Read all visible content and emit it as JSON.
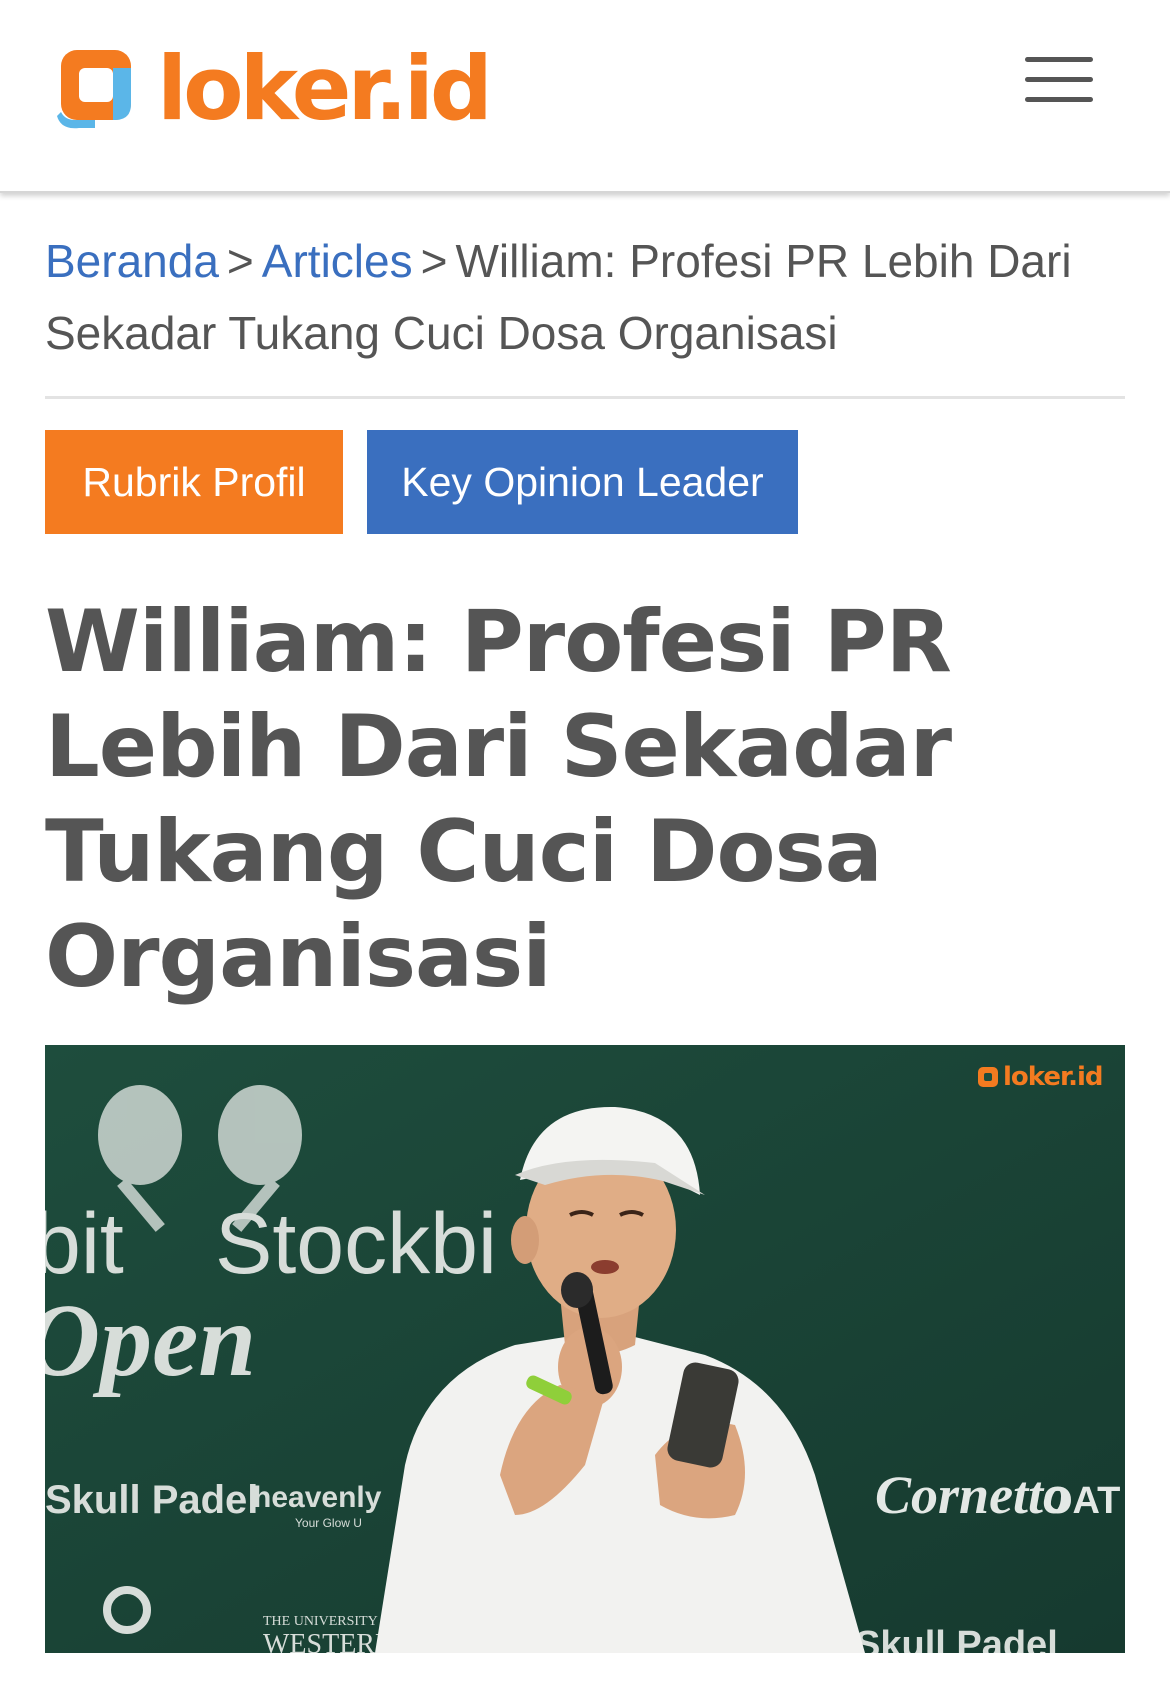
{
  "header": {
    "logo_text": "loker.id",
    "menu_icon": "hamburger-menu-icon"
  },
  "breadcrumb": {
    "home": "Beranda",
    "section": "Articles",
    "separator": ">",
    "current": "William: Profesi PR Lebih Dari Sekadar Tukang Cuci Dosa Organisasi"
  },
  "tags": {
    "primary": "Rubrik Profil",
    "secondary": "Key Opinion Leader"
  },
  "article": {
    "title": "William: Profesi PR Lebih Dari Sekadar Tukang Cuci Dosa Organisasi"
  },
  "hero_image": {
    "watermark": "loker.id",
    "backdrop_texts": [
      "bit",
      "Stockbi",
      "Open",
      "Skull Padel",
      "heavenly",
      "Your Glow U",
      "Cornetto",
      "OAT",
      "THE UNIVERSITY OF",
      "WESTERN",
      "Skull Padel"
    ]
  },
  "colors": {
    "brand_orange": "#f47b20",
    "brand_blue": "#3a6fbf",
    "text_gray": "#555555",
    "hero_bg": "#1c4a3a"
  }
}
